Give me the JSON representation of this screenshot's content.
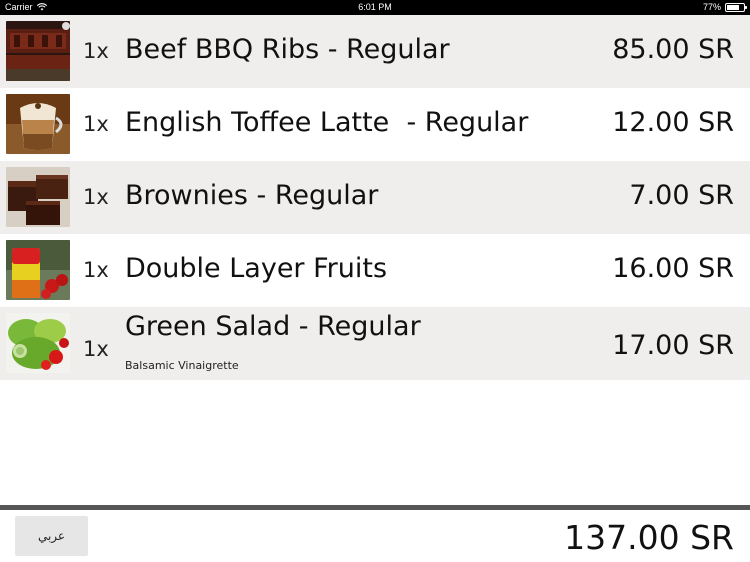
{
  "status_bar": {
    "carrier": "Carrier",
    "time": "6:01 PM",
    "battery": "77%",
    "battery_level": 0.77
  },
  "order_items": [
    {
      "qty": "1x",
      "name": "Beef BBQ Ribs - Regular",
      "price": "85.00 SR",
      "modifier": "",
      "image_icon": "bbq-ribs-photo"
    },
    {
      "qty": "1x",
      "name": "English Toffee Latte  - Regular",
      "price": "12.00 SR",
      "modifier": "",
      "image_icon": "toffee-latte-photo"
    },
    {
      "qty": "1x",
      "name": "Brownies - Regular",
      "price": "7.00 SR",
      "modifier": "",
      "image_icon": "brownies-photo"
    },
    {
      "qty": "1x",
      "name": "Double Layer Fruits",
      "price": "16.00 SR",
      "modifier": "",
      "image_icon": "fruit-drink-photo"
    },
    {
      "qty": "1x",
      "name": "Green Salad - Regular",
      "price": "17.00 SR",
      "modifier": "Balsamic Vinaigrette",
      "image_icon": "green-salad-photo"
    }
  ],
  "footer": {
    "language_button": "عربي",
    "total": "137.00 SR"
  },
  "colors": {
    "row_shaded": "#efeeec",
    "row_plain": "#ffffff",
    "divider": "#555555",
    "button_bg": "#e6e6e6"
  }
}
